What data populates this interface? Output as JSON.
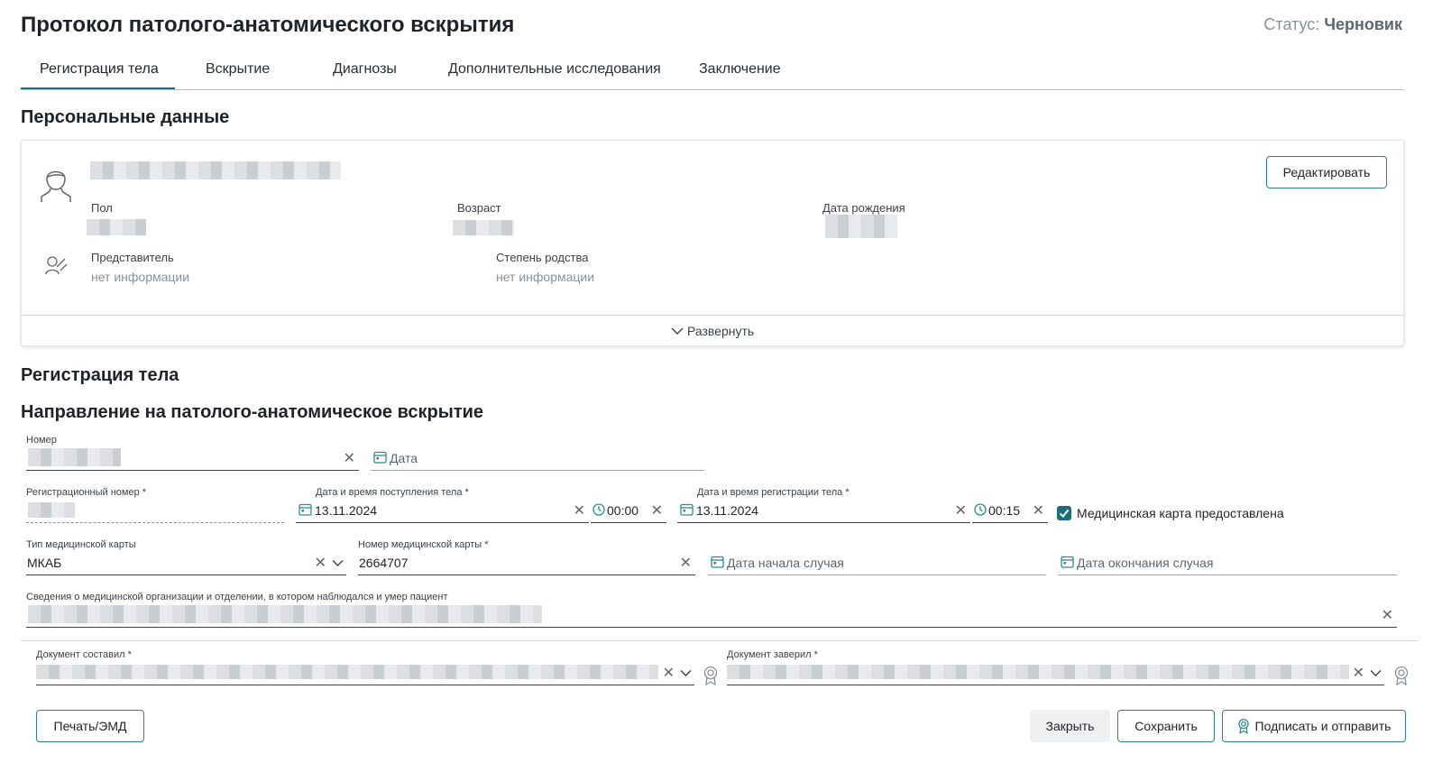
{
  "page": {
    "title": "Протокол патолого-анатомического вскрытия",
    "status_label": "Статус:",
    "status_value": "Черновик"
  },
  "tabs": [
    {
      "label": "Регистрация тела",
      "active": true
    },
    {
      "label": "Вскрытие"
    },
    {
      "label": "Диагнозы"
    },
    {
      "label": "Дополнительные исследования"
    },
    {
      "label": "Заключение"
    }
  ],
  "personal": {
    "heading": "Персональные данные",
    "edit_label": "Редактировать",
    "sex_label": "Пол",
    "age_label": "Возраст",
    "birth_label": "Дата рождения",
    "rep_label": "Представитель",
    "rep_value": "нет информации",
    "kin_label": "Степень родства",
    "kin_value": "нет информации",
    "expand_label": "Развернуть"
  },
  "registration": {
    "heading": "Регистрация тела",
    "subheading": "Направление на патолого-анатомическое вскрытие",
    "number_label": "Номер",
    "date_placeholder": "Дата",
    "reg_number_label": "Регистрационный номер *",
    "arrival_label": "Дата и время поступления тела *",
    "arrival_date": "13.11.2024",
    "arrival_time": "00:00",
    "reg_dt_label": "Дата и время регистрации тела *",
    "reg_date": "13.11.2024",
    "reg_time": "00:15",
    "med_card_provided": "Медицинская карта предоставлена",
    "card_type_label": "Тип медицинской карты",
    "card_type_value": "МКАБ",
    "card_number_label": "Номер медицинской карты *",
    "card_number_value": "2664707",
    "case_start_placeholder": "Дата начала случая",
    "case_end_placeholder": "Дата окончания случая",
    "org_label": "Сведения о медицинской организации и отделении, в котором наблюдался и умер пациент"
  },
  "signers": {
    "composed_label": "Документ составил *",
    "certified_label": "Документ заверил *"
  },
  "footer": {
    "print_label": "Печать/ЭМД",
    "close_label": "Закрыть",
    "save_label": "Сохранить",
    "sign_label": "Подписать и отправить"
  },
  "colors": {
    "accent": "#1b6f7d",
    "icon": "#2a8b98",
    "text": "#1f2329",
    "muted": "#8a9099"
  }
}
